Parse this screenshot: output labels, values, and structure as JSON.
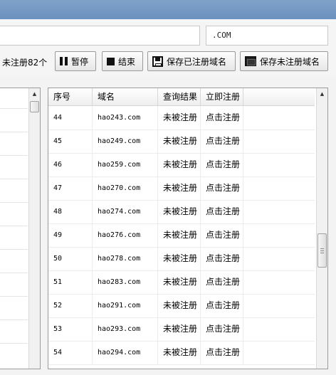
{
  "toolbar": {
    "domain_input_value": "",
    "suffix_input_value": ".COM",
    "status_text": "未注册82个",
    "pause_label": "暂停",
    "stop_label": "结束",
    "save_registered_label": "保存已注册域名",
    "save_unregistered_label": "保存未注册域名"
  },
  "results_grid": {
    "columns": [
      "序号",
      "域名",
      "查询结果",
      "立即注册"
    ],
    "rows": [
      {
        "no": "44",
        "domain": "hao243.com",
        "result": "未被注册",
        "action": "点击注册"
      },
      {
        "no": "45",
        "domain": "hao249.com",
        "result": "未被注册",
        "action": "点击注册"
      },
      {
        "no": "46",
        "domain": "hao259.com",
        "result": "未被注册",
        "action": "点击注册"
      },
      {
        "no": "47",
        "domain": "hao270.com",
        "result": "未被注册",
        "action": "点击注册"
      },
      {
        "no": "48",
        "domain": "hao274.com",
        "result": "未被注册",
        "action": "点击注册"
      },
      {
        "no": "49",
        "domain": "hao276.com",
        "result": "未被注册",
        "action": "点击注册"
      },
      {
        "no": "50",
        "domain": "hao278.com",
        "result": "未被注册",
        "action": "点击注册"
      },
      {
        "no": "51",
        "domain": "hao283.com",
        "result": "未被注册",
        "action": "点击注册"
      },
      {
        "no": "52",
        "domain": "hao291.com",
        "result": "未被注册",
        "action": "点击注册"
      },
      {
        "no": "53",
        "domain": "hao293.com",
        "result": "未被注册",
        "action": "点击注册"
      },
      {
        "no": "54",
        "domain": "hao294.com",
        "result": "未被注册",
        "action": "点击注册"
      }
    ]
  },
  "icons": {
    "pause": "pause-icon",
    "stop": "stop-icon",
    "save": "floppy-disk-icon",
    "window": "window-icon",
    "scroll_up": "chevron-up-icon"
  }
}
